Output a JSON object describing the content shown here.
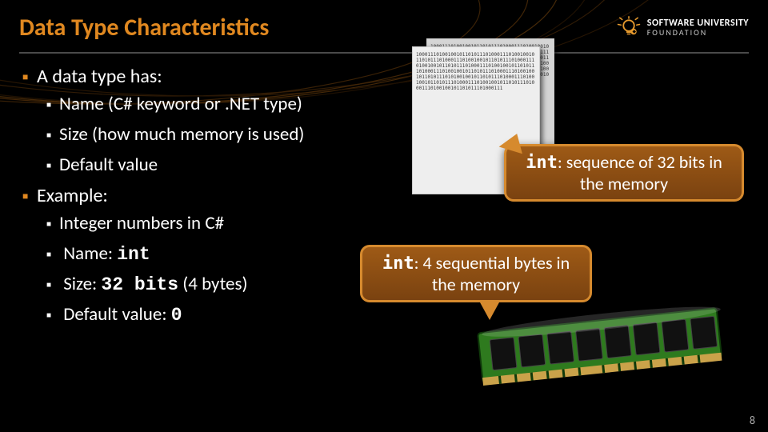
{
  "header": {
    "title": "Data Type Characteristics",
    "logo_line1": "SOFTWARE UNIVERSITY",
    "logo_line2": "FOUNDATION"
  },
  "bullets": {
    "l1a": "A data type has:",
    "l2a": "Name (C# keyword or .NET type)",
    "l2b": "Size (how much memory is used)",
    "l2c": "Default value",
    "l1b": "Example:",
    "l2d": "Integer numbers in C#",
    "l2e_pre": "Name: ",
    "l2e_mono": "int",
    "l2f_pre": "Size: ",
    "l2f_mono": "32 bits",
    "l2f_post": " (4 bytes)",
    "l2g_pre": "Default value: ",
    "l2g_mono": "0"
  },
  "callout_a": {
    "mono": "int",
    "rest": ": sequence of 32 bits in the memory"
  },
  "callout_b": {
    "mono": "int",
    "rest": ": 4 sequential bytes in the memory"
  },
  "binary_fill": "100011101001001011010111010001110100100101101011101000111010010010110101110100011101001001011010111010001110100100101101011101000111010010010110101110100011101001001011010111010100100101101011101000111010010010110101110100011101001001011010111010001110100100101101011101000111",
  "page_number": "8"
}
